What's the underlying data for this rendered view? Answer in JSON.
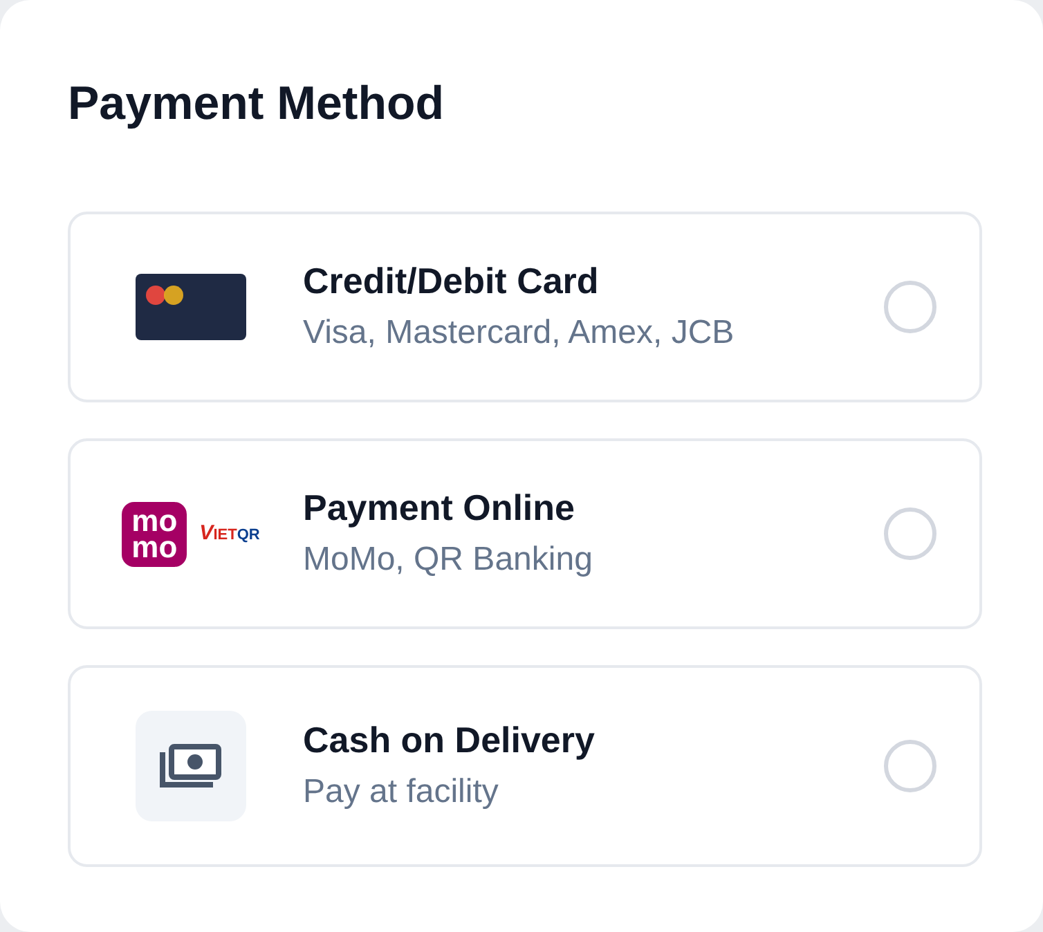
{
  "title": "Payment Method",
  "options": [
    {
      "kind": "card",
      "title": "Credit/Debit Card",
      "description": "Visa, Mastercard, Amex, JCB",
      "selected": false
    },
    {
      "kind": "online",
      "title": "Payment Online",
      "description": "MoMo, QR Banking",
      "selected": false,
      "momo_logo": {
        "text": "momo"
      },
      "vietqr_logo": {
        "parts": [
          "V",
          "IET",
          "QR"
        ]
      }
    },
    {
      "kind": "cash",
      "title": "Cash on Delivery",
      "description": "Pay at facility",
      "selected": false
    }
  ]
}
